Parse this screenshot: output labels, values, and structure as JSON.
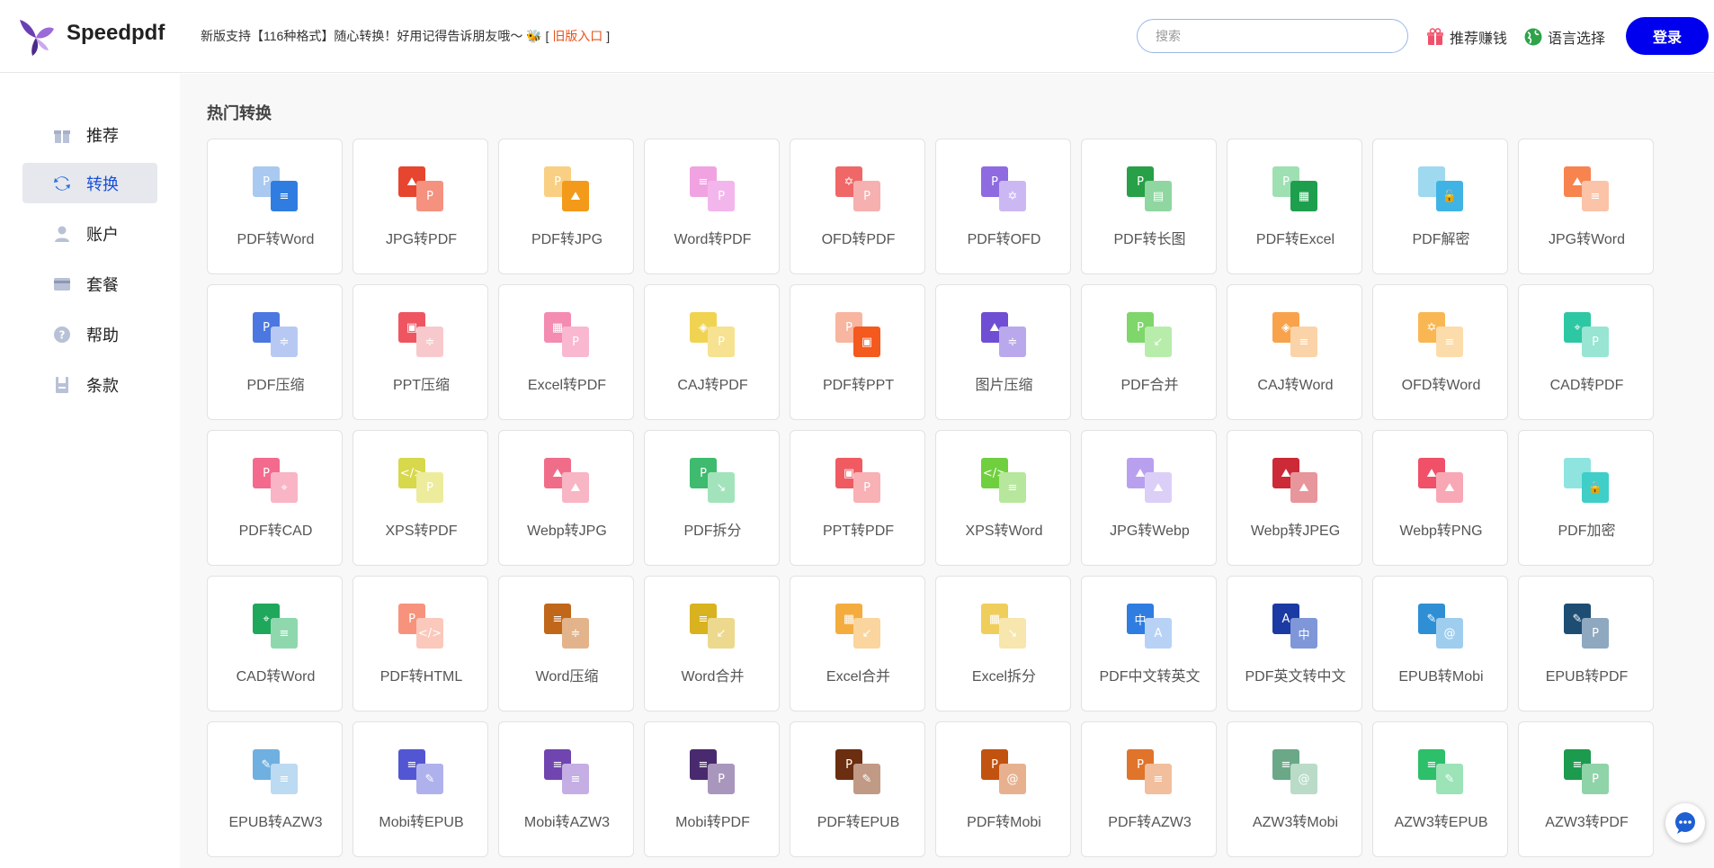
{
  "header": {
    "logo_text": "Speedpdf",
    "notice_text": "新版支持【116种格式】随心转换！好用记得告诉朋友哦～ 🐝 ",
    "notice_bracket_open": "[",
    "old_version_link": "旧版入口",
    "notice_bracket_close": "]",
    "search_placeholder": "搜索",
    "referral_label": "推荐赚钱",
    "language_label": "语言选择",
    "login_label": "登录"
  },
  "sidebar": {
    "items": [
      {
        "label": "推荐",
        "icon": "gift-icon",
        "active": false
      },
      {
        "label": "转换",
        "icon": "convert-icon",
        "active": true
      },
      {
        "label": "账户",
        "icon": "user-icon",
        "active": false
      },
      {
        "label": "套餐",
        "icon": "card-icon",
        "active": false
      },
      {
        "label": "帮助",
        "icon": "help-icon",
        "active": false
      },
      {
        "label": "条款",
        "icon": "terms-icon",
        "active": false
      }
    ]
  },
  "main": {
    "section_title": "热门转换",
    "cards": [
      {
        "label": "PDF转Word",
        "back": "#a9c9f0",
        "front": "#2f7de0",
        "bt": "P",
        "ft": "≡"
      },
      {
        "label": "JPG转PDF",
        "back": "#e6452f",
        "front": "#f4917f",
        "bt": "⛰",
        "ft": "P"
      },
      {
        "label": "PDF转JPG",
        "back": "#f9cf83",
        "front": "#f39a1a",
        "bt": "P",
        "ft": "⛰"
      },
      {
        "label": "Word转PDF",
        "back": "#f1a3e1",
        "front": "#f3b6ec",
        "bt": "≡",
        "ft": "P"
      },
      {
        "label": "OFD转PDF",
        "back": "#ef6767",
        "front": "#f6b0b0",
        "bt": "✡",
        "ft": "P"
      },
      {
        "label": "PDF转OFD",
        "back": "#8e6be0",
        "front": "#cbb8f2",
        "bt": "P",
        "ft": "✡"
      },
      {
        "label": "PDF转长图",
        "back": "#27a047",
        "front": "#8fd6a0",
        "bt": "P",
        "ft": "▤"
      },
      {
        "label": "PDF转Excel",
        "back": "#9fe0b3",
        "front": "#1e9f4e",
        "bt": "P",
        "ft": "▦"
      },
      {
        "label": "PDF解密",
        "back": "#9fd9ef",
        "front": "#3fb4e4",
        "bt": "",
        "ft": "🔓"
      },
      {
        "label": "JPG转Word",
        "back": "#f7834f",
        "front": "#fbc4a8",
        "bt": "⛰",
        "ft": "≡"
      },
      {
        "label": "PDF压缩",
        "back": "#4b77e0",
        "front": "#b7c9f3",
        "bt": "P",
        "ft": "≑"
      },
      {
        "label": "PPT压缩",
        "back": "#ef5560",
        "front": "#f8c9cc",
        "bt": "▣",
        "ft": "≑"
      },
      {
        "label": "Excel转PDF",
        "back": "#f48bb1",
        "front": "#f9b8d0",
        "bt": "▦",
        "ft": "P"
      },
      {
        "label": "CAJ转PDF",
        "back": "#f1d352",
        "front": "#f6e290",
        "bt": "◈",
        "ft": "P"
      },
      {
        "label": "PDF转PPT",
        "back": "#f8b5a0",
        "front": "#f4591e",
        "bt": "P",
        "ft": "▣"
      },
      {
        "label": "图片压缩",
        "back": "#6f4ed4",
        "front": "#baa8ec",
        "bt": "⛰",
        "ft": "≑"
      },
      {
        "label": "PDF合并",
        "back": "#7fd66a",
        "front": "#b8ecab",
        "bt": "P",
        "ft": "↙"
      },
      {
        "label": "CAJ转Word",
        "back": "#f8a34c",
        "front": "#fbd3a8",
        "bt": "◈",
        "ft": "≡"
      },
      {
        "label": "OFD转Word",
        "back": "#f9b753",
        "front": "#fcdcab",
        "bt": "✡",
        "ft": "≡"
      },
      {
        "label": "CAD转PDF",
        "back": "#2ec7a3",
        "front": "#97e5d2",
        "bt": "⌖",
        "ft": "P"
      },
      {
        "label": "PDF转CAD",
        "back": "#f36a8e",
        "front": "#f9b4c6",
        "bt": "P",
        "ft": "⌖"
      },
      {
        "label": "XPS转PDF",
        "back": "#d7d84c",
        "front": "#ecec9c",
        "bt": "</>",
        "ft": "P"
      },
      {
        "label": "Webp转JPG",
        "back": "#f06d8a",
        "front": "#f8b5c4",
        "bt": "⛰",
        "ft": "⛰"
      },
      {
        "label": "PDF拆分",
        "back": "#3ebb6e",
        "front": "#a3e3bb",
        "bt": "P",
        "ft": "↘"
      },
      {
        "label": "PPT转PDF",
        "back": "#f05b62",
        "front": "#f8b1b4",
        "bt": "▣",
        "ft": "P"
      },
      {
        "label": "XPS转Word",
        "back": "#70cf3f",
        "front": "#b6e79c",
        "bt": "</>",
        "ft": "≡"
      },
      {
        "label": "JPG转Webp",
        "back": "#b9a0ef",
        "front": "#dccff7",
        "bt": "⛰",
        "ft": "⛰"
      },
      {
        "label": "Webp转JPEG",
        "back": "#cc2a37",
        "front": "#e7969b",
        "bt": "⛰",
        "ft": "⛰"
      },
      {
        "label": "Webp转PNG",
        "back": "#f05068",
        "front": "#f8a8b4",
        "bt": "⛰",
        "ft": "⛰"
      },
      {
        "label": "PDF加密",
        "back": "#8fe4e0",
        "front": "#3fcfc8",
        "bt": "",
        "ft": "🔒"
      },
      {
        "label": "CAD转Word",
        "back": "#1fa85c",
        "front": "#8fd8ae",
        "bt": "⌖",
        "ft": "≡"
      },
      {
        "label": "PDF转HTML",
        "back": "#f7937c",
        "front": "#fbc8bc",
        "bt": "P",
        "ft": "</>"
      },
      {
        "label": "Word压缩",
        "back": "#c0671a",
        "front": "#e3b48b",
        "bt": "≡",
        "ft": "≑"
      },
      {
        "label": "Word合并",
        "back": "#d8b21f",
        "front": "#ecd98e",
        "bt": "≡",
        "ft": "↙"
      },
      {
        "label": "Excel合并",
        "back": "#f5ac3e",
        "front": "#fad59e",
        "bt": "▦",
        "ft": "↙"
      },
      {
        "label": "Excel拆分",
        "back": "#f0ce5c",
        "front": "#f7e6ad",
        "bt": "▦",
        "ft": "↘"
      },
      {
        "label": "PDF中文转英文",
        "back": "#2f7de0",
        "front": "#b7d2f5",
        "bt": "中",
        "ft": "A"
      },
      {
        "label": "PDF英文转中文",
        "back": "#1b3aa3",
        "front": "#7f97d8",
        "bt": "A",
        "ft": "中"
      },
      {
        "label": "EPUB转Mobi",
        "back": "#2f8fd4",
        "front": "#9fcdee",
        "bt": "✎",
        "ft": "@"
      },
      {
        "label": "EPUB转PDF",
        "back": "#1e4d73",
        "front": "#8ea8bf",
        "bt": "✎",
        "ft": "P"
      },
      {
        "label": "EPUB转AZW3",
        "back": "#6fb0e0",
        "front": "#bcdaf1",
        "bt": "✎",
        "ft": "≡"
      },
      {
        "label": "Mobi转EPUB",
        "back": "#5356d2",
        "front": "#afb1ec",
        "bt": "≡",
        "ft": "✎"
      },
      {
        "label": "Mobi转AZW3",
        "back": "#7145b0",
        "front": "#c4aee3",
        "bt": "≡",
        "ft": "≡"
      },
      {
        "label": "Mobi转PDF",
        "back": "#4a2a6e",
        "front": "#a996bd",
        "bt": "≡",
        "ft": "P"
      },
      {
        "label": "PDF转EPUB",
        "back": "#6b2e10",
        "front": "#c19a85",
        "bt": "P",
        "ft": "✎"
      },
      {
        "label": "PDF转Mobi",
        "back": "#c2520f",
        "front": "#e7b190",
        "bt": "P",
        "ft": "@"
      },
      {
        "label": "PDF转AZW3",
        "back": "#e0742a",
        "front": "#f1bf9d",
        "bt": "P",
        "ft": "≡"
      },
      {
        "label": "AZW3转Mobi",
        "back": "#6aa887",
        "front": "#b9dbc8",
        "bt": "≡",
        "ft": "@"
      },
      {
        "label": "AZW3转EPUB",
        "back": "#2dbf6a",
        "front": "#9ce3b8",
        "bt": "≡",
        "ft": "✎"
      },
      {
        "label": "AZW3转PDF",
        "back": "#1c9a4e",
        "front": "#8fd3a9",
        "bt": "≡",
        "ft": "P"
      }
    ]
  }
}
